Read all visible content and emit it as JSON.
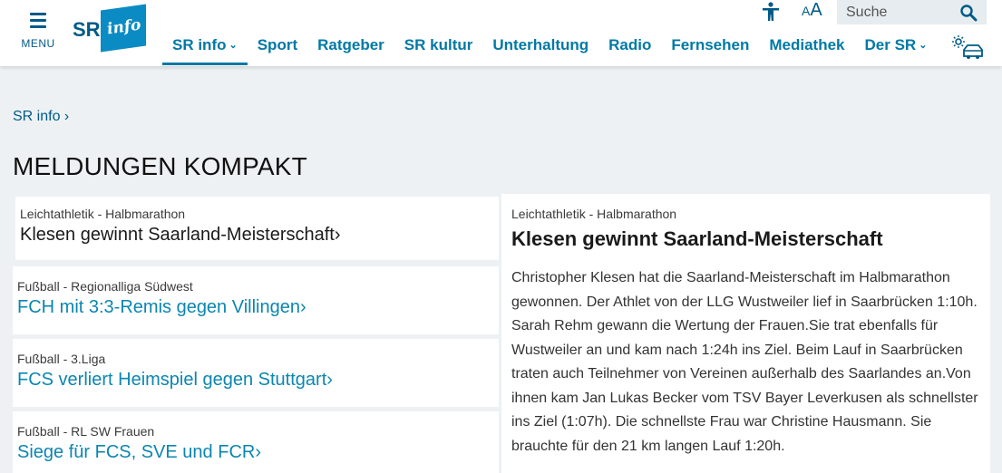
{
  "header": {
    "menu_label": "MENU",
    "logo": {
      "sr": "SR",
      "info": "info"
    },
    "nav": [
      {
        "label": "SR info",
        "has_dropdown": true,
        "active": true
      },
      {
        "label": "Sport"
      },
      {
        "label": "Ratgeber"
      },
      {
        "label": "SR kultur"
      },
      {
        "label": "Unterhaltung"
      },
      {
        "label": "Radio"
      },
      {
        "label": "Fernsehen"
      },
      {
        "label": "Mediathek"
      },
      {
        "label": "Der SR",
        "has_dropdown": true
      }
    ],
    "font_size_toggle": {
      "big": "A",
      "small": "A"
    },
    "search": {
      "placeholder": "Suche"
    },
    "icons": [
      "accessibility-icon",
      "font-size-icon",
      "search-icon",
      "traffic-weather-icon"
    ],
    "chevron": "⌄"
  },
  "breadcrumb": "SR info ›",
  "page_title": "MELDUNGEN KOMPAKT",
  "news_list": [
    {
      "topic": "Leichtathletik - Halbmarathon",
      "headline": "Klesen gewinnt Saarland-Meisterschaft›",
      "active": true
    },
    {
      "topic": "Fußball - Regionalliga Südwest",
      "headline": "FCH mit 3:3-Remis gegen Villingen›"
    },
    {
      "topic": "Fußball - 3.Liga",
      "headline": "FCS verliert Heimspiel gegen Stuttgart›"
    },
    {
      "topic": "Fußball - RL SW Frauen",
      "headline": "Siege für FCS, SVE und FCR›"
    }
  ],
  "article": {
    "topic": "Leichtathletik - Halbmarathon",
    "headline": "Klesen gewinnt Saarland-Meisterschaft",
    "body": "Christopher Klesen hat die Saarland-Meisterschaft im Halbmarathon gewonnen. Der Athlet von der LLG Wustweiler lief in Saarbrücken 1:10h. Sarah Rehm gewann die Wertung der Frauen.Sie trat ebenfalls für Wustweiler an und kam nach 1:24h ins Ziel. Beim Lauf in Saarbrücken traten auch Teilnehmer von Vereinen außerhalb des Saarlandes an.Von ihnen kam Jan Lukas Becker vom TSV Bayer Leverkusen als schnellster ins Ziel (1:07h). Die schnellste Frau war Christine Hausmann. Sie brauchte für den 21 km langen Lauf 1:20h."
  },
  "colors": {
    "brand": "#005a87",
    "link": "#0b86b0",
    "logo_box": "#0b8bc4",
    "background": "#edf1f3"
  }
}
